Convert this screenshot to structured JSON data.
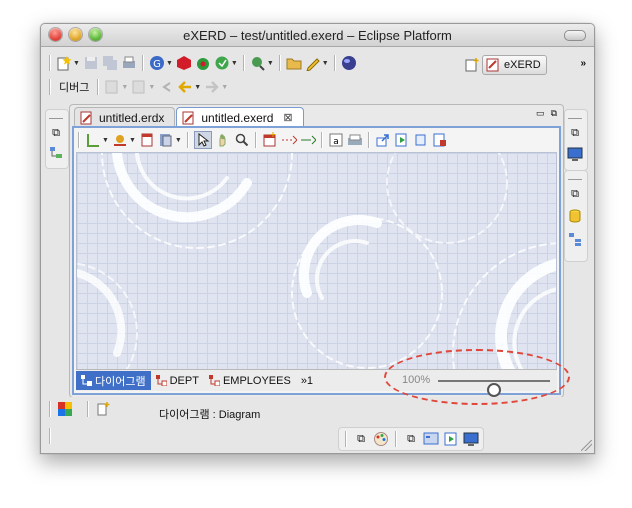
{
  "window": {
    "title": "eXERD – test/untitled.exerd – Eclipse Platform"
  },
  "toolbar": {
    "debug_label": "디버그",
    "perspective_label": "eXERD",
    "more_label": "»"
  },
  "editor": {
    "tabs": [
      {
        "label": "untitled.erdx",
        "active": false
      },
      {
        "label": "untitled.exerd",
        "active": true
      }
    ],
    "close_glyph": "⊠",
    "bottom_tabs": [
      {
        "label": "다이어그램",
        "active": true
      },
      {
        "label": "DEPT",
        "active": false
      },
      {
        "label": "EMPLOYEES",
        "active": false
      }
    ],
    "overflow_label": "»1",
    "zoom": {
      "label": "100%",
      "level": 0.5
    }
  },
  "status": {
    "text": "다이어그램 : Diagram"
  },
  "colors": {
    "selection": "#3f6fc7",
    "editor_border": "#7ea1d8",
    "annotation": "#e0463a"
  },
  "icons": [
    "new-icon",
    "save-icon",
    "print-icon",
    "globe-icon",
    "run-icon",
    "debug-icon",
    "search-icon",
    "folder-icon",
    "pencil-icon",
    "sphere-icon",
    "back-icon",
    "forward-icon",
    "pointer-icon",
    "hand-icon",
    "zoom-icon",
    "table-icon",
    "relation-icon",
    "text-icon",
    "export-icon",
    "diagram-icon"
  ]
}
